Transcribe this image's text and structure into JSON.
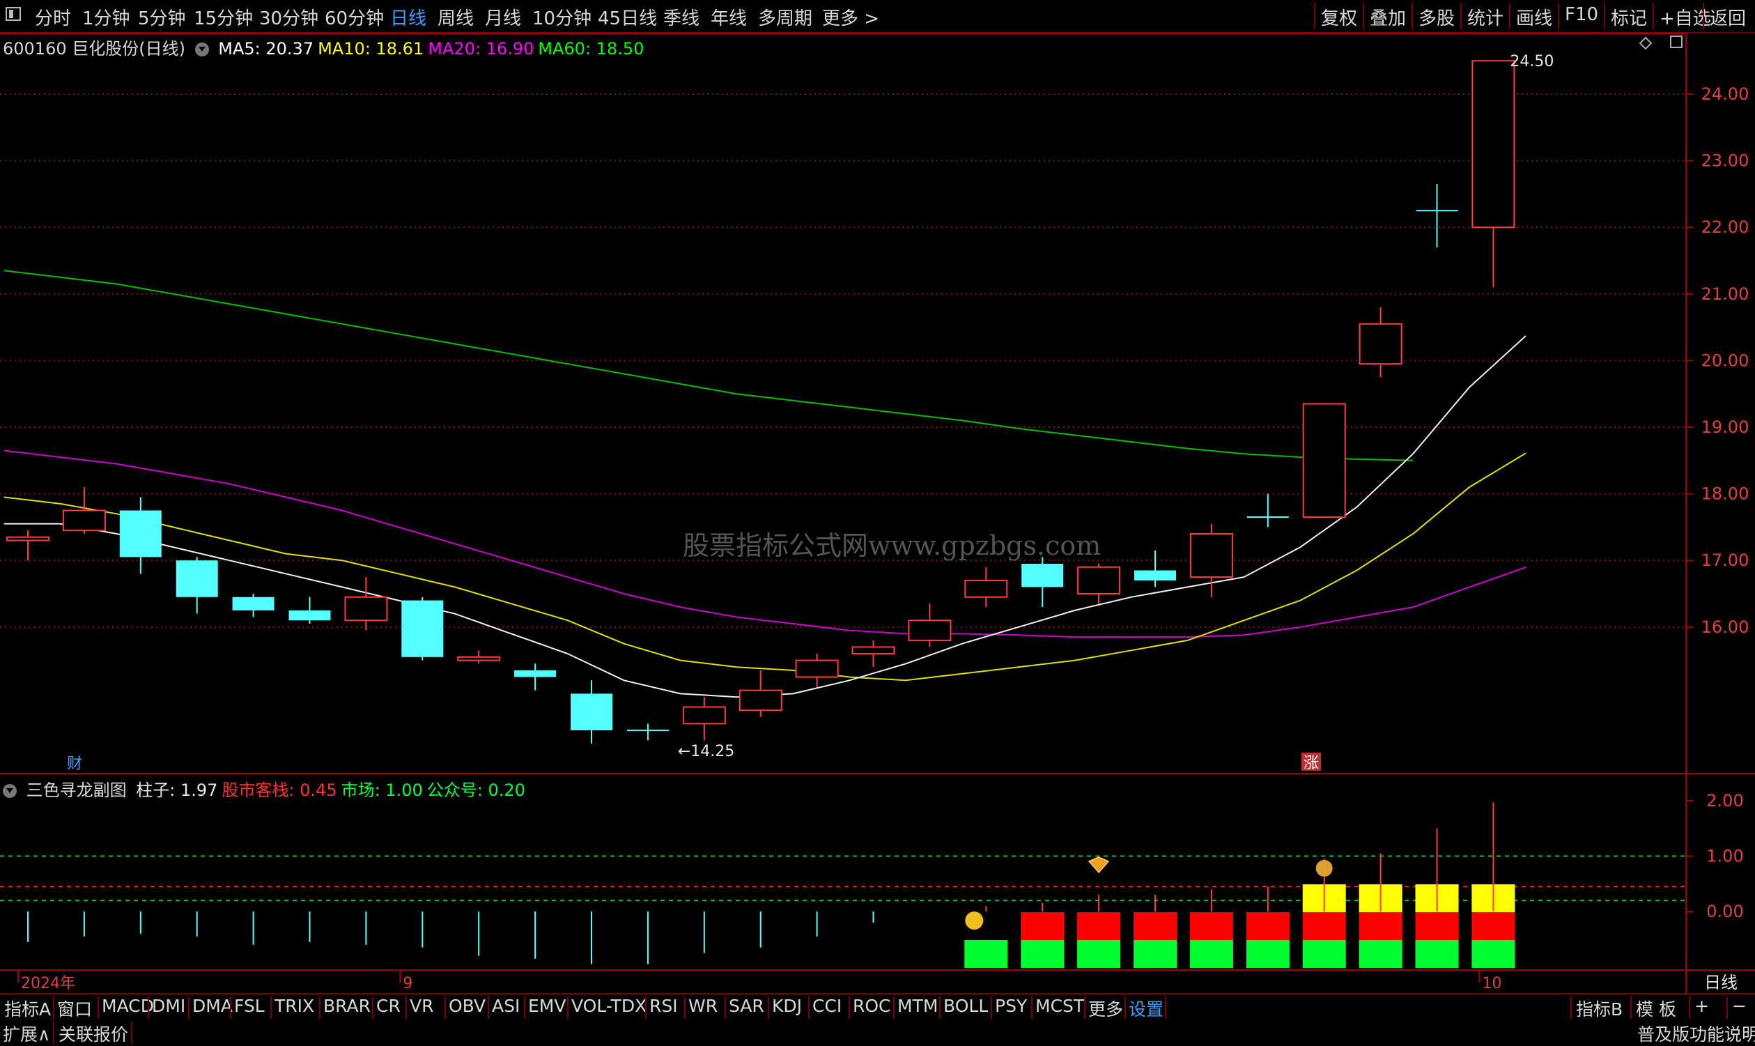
{
  "toolbar": {
    "periods": [
      "分时",
      "1分钟",
      "5分钟",
      "15分钟",
      "30分钟",
      "60分钟",
      "日线",
      "周线",
      "月线",
      "10分钟",
      "45日线",
      "季线",
      "年线",
      "多周期",
      "更多 >"
    ],
    "active_period": "日线",
    "right_tools": [
      "复权",
      "叠加",
      "多股",
      "统计",
      "画线",
      "F10",
      "标记",
      "+自选",
      "返回"
    ]
  },
  "main_chart": {
    "title": "600160 巨化股份(日线)",
    "ma": [
      {
        "label": "MA5: 20.37",
        "color": "#ffffff"
      },
      {
        "label": "MA10: 18.61",
        "color": "#ffff00"
      },
      {
        "label": "MA20: 16.90",
        "color": "#ff00ff"
      },
      {
        "label": "MA60: 18.50",
        "color": "#00ff00"
      }
    ],
    "y_axis": [
      "24.00",
      "23.00",
      "22.00",
      "21.00",
      "20.00",
      "19.00",
      "18.00",
      "17.00",
      "16.00"
    ],
    "high_label": "24.50",
    "low_label": "←14.25",
    "marker_cai": "财",
    "marker_zhang": "涨",
    "watermark": "股票指标公式网www.gpzbgs.com"
  },
  "chart_data": {
    "type": "candlestick",
    "candles": [
      {
        "o": 17.3,
        "c": 17.35,
        "h": 17.45,
        "l": 17.0
      },
      {
        "o": 17.45,
        "c": 17.75,
        "h": 18.1,
        "l": 17.4
      },
      {
        "o": 17.75,
        "c": 17.05,
        "h": 17.95,
        "l": 16.8
      },
      {
        "o": 17.0,
        "c": 16.45,
        "h": 17.05,
        "l": 16.2
      },
      {
        "o": 16.45,
        "c": 16.25,
        "h": 16.5,
        "l": 16.15
      },
      {
        "o": 16.25,
        "c": 16.1,
        "h": 16.45,
        "l": 16.05
      },
      {
        "o": 16.1,
        "c": 16.45,
        "h": 16.75,
        "l": 15.95
      },
      {
        "o": 16.4,
        "c": 15.55,
        "h": 16.45,
        "l": 15.5
      },
      {
        "o": 15.5,
        "c": 15.55,
        "h": 15.65,
        "l": 15.45
      },
      {
        "o": 15.35,
        "c": 15.25,
        "h": 15.45,
        "l": 15.05
      },
      {
        "o": 15.0,
        "c": 14.45,
        "h": 15.2,
        "l": 14.25
      },
      {
        "o": 14.45,
        "c": 14.45,
        "h": 14.55,
        "l": 14.3
      },
      {
        "o": 14.55,
        "c": 14.8,
        "h": 14.95,
        "l": 14.3
      },
      {
        "o": 14.75,
        "c": 15.05,
        "h": 15.35,
        "l": 14.65
      },
      {
        "o": 15.25,
        "c": 15.5,
        "h": 15.6,
        "l": 15.1
      },
      {
        "o": 15.6,
        "c": 15.7,
        "h": 15.8,
        "l": 15.4
      },
      {
        "o": 15.8,
        "c": 16.1,
        "h": 16.35,
        "l": 15.7
      },
      {
        "o": 16.45,
        "c": 16.7,
        "h": 16.9,
        "l": 16.3
      },
      {
        "o": 16.95,
        "c": 16.6,
        "h": 17.05,
        "l": 16.3
      },
      {
        "o": 16.5,
        "c": 16.9,
        "h": 16.95,
        "l": 16.35
      },
      {
        "o": 16.85,
        "c": 16.7,
        "h": 17.15,
        "l": 16.6
      },
      {
        "o": 16.75,
        "c": 17.4,
        "h": 17.55,
        "l": 16.45
      },
      {
        "o": 17.65,
        "c": 17.65,
        "h": 18.0,
        "l": 17.5
      },
      {
        "o": 17.65,
        "c": 19.35,
        "h": 19.35,
        "l": 17.65
      },
      {
        "o": 19.95,
        "c": 20.55,
        "h": 20.8,
        "l": 19.75
      },
      {
        "o": 22.25,
        "c": 22.25,
        "h": 22.65,
        "l": 21.7
      },
      {
        "o": 22.0,
        "c": 24.5,
        "h": 24.5,
        "l": 21.1
      }
    ],
    "ma5": [
      17.55,
      17.55,
      17.4,
      17.2,
      17.0,
      16.8,
      16.6,
      16.4,
      16.2,
      15.9,
      15.6,
      15.2,
      15.0,
      14.95,
      15.0,
      15.2,
      15.45,
      15.75,
      16.0,
      16.25,
      16.45,
      16.6,
      16.75,
      17.2,
      17.8,
      18.6,
      19.6,
      20.37
    ],
    "ma10": [
      17.95,
      17.85,
      17.7,
      17.5,
      17.3,
      17.1,
      17.0,
      16.8,
      16.6,
      16.35,
      16.1,
      15.75,
      15.5,
      15.4,
      15.35,
      15.25,
      15.2,
      15.3,
      15.4,
      15.5,
      15.65,
      15.8,
      16.1,
      16.4,
      16.85,
      17.4,
      18.1,
      18.61
    ],
    "ma20": [
      18.65,
      18.55,
      18.45,
      18.3,
      18.15,
      17.95,
      17.75,
      17.5,
      17.25,
      17.0,
      16.75,
      16.5,
      16.3,
      16.15,
      16.05,
      15.95,
      15.9,
      15.9,
      15.88,
      15.85,
      15.85,
      15.85,
      15.88,
      16.0,
      16.15,
      16.3,
      16.6,
      16.9
    ],
    "ma60": [
      21.35,
      21.25,
      21.15,
      21.0,
      20.85,
      20.7,
      20.55,
      20.4,
      20.25,
      20.1,
      19.95,
      19.8,
      19.65,
      19.5,
      19.4,
      19.3,
      19.2,
      19.1,
      18.98,
      18.88,
      18.78,
      18.68,
      18.6,
      18.55,
      18.52,
      18.5
    ]
  },
  "sub_chart": {
    "name": "三色寻龙副图",
    "values": [
      {
        "label": "柱子: 1.97",
        "color": "#e8e8e8"
      },
      {
        "label": "股市客栈: 0.45",
        "color": "#ff3030"
      },
      {
        "label": "市场: 1.00",
        "color": "#00ff40"
      },
      {
        "label": "公众号: 0.20",
        "color": "#00ff40"
      }
    ],
    "y_axis": [
      "2.00",
      "1.00",
      "0.00"
    ],
    "bars": [
      -0.55,
      -0.45,
      -0.4,
      -0.45,
      -0.6,
      -0.55,
      -0.6,
      -0.65,
      -0.8,
      -0.85,
      -0.95,
      -0.95,
      -0.75,
      -0.65,
      -0.45,
      -0.2,
      0.0,
      0.1,
      0.15,
      0.3,
      0.3,
      0.4,
      0.45,
      0.95,
      1.05,
      1.5,
      1.97
    ],
    "stack_green": [
      0,
      0,
      0,
      0,
      0,
      0,
      0,
      0,
      0,
      0,
      0,
      0,
      0,
      0,
      0,
      0,
      0,
      1,
      1,
      1,
      1,
      1,
      1,
      1,
      1,
      1,
      1
    ],
    "stack_red": [
      0,
      0,
      0,
      0,
      0,
      0,
      0,
      0,
      0,
      0,
      0,
      0,
      0,
      0,
      0,
      0,
      0,
      0,
      1,
      1,
      1,
      1,
      1,
      1,
      1,
      1,
      1
    ],
    "stack_yellow": [
      0,
      0,
      0,
      0,
      0,
      0,
      0,
      0,
      0,
      0,
      0,
      0,
      0,
      0,
      0,
      0,
      0,
      0,
      0,
      0,
      0,
      0,
      0,
      1,
      1,
      1,
      1
    ]
  },
  "time_axis": {
    "labels": [
      "2024年",
      "9",
      "10"
    ],
    "right_label": "日线"
  },
  "indicator_tabs": [
    "指标A",
    "窗口",
    "MACD",
    "DMI",
    "DMA",
    "FSL",
    "TRIX",
    "BRAR",
    "CR",
    "VR",
    "OBV",
    "ASI",
    "EMV",
    "VOL-TDX",
    "RSI",
    "WR",
    "SAR",
    "KDJ",
    "CCI",
    "ROC",
    "MTM",
    "BOLL",
    "PSY",
    "MCST",
    "更多",
    "设置"
  ],
  "indicator_right": [
    "指标B",
    "模 板",
    "+",
    "−"
  ],
  "status": {
    "left": [
      "扩展∧",
      "关联报价"
    ],
    "right": "普及版功能说明"
  }
}
